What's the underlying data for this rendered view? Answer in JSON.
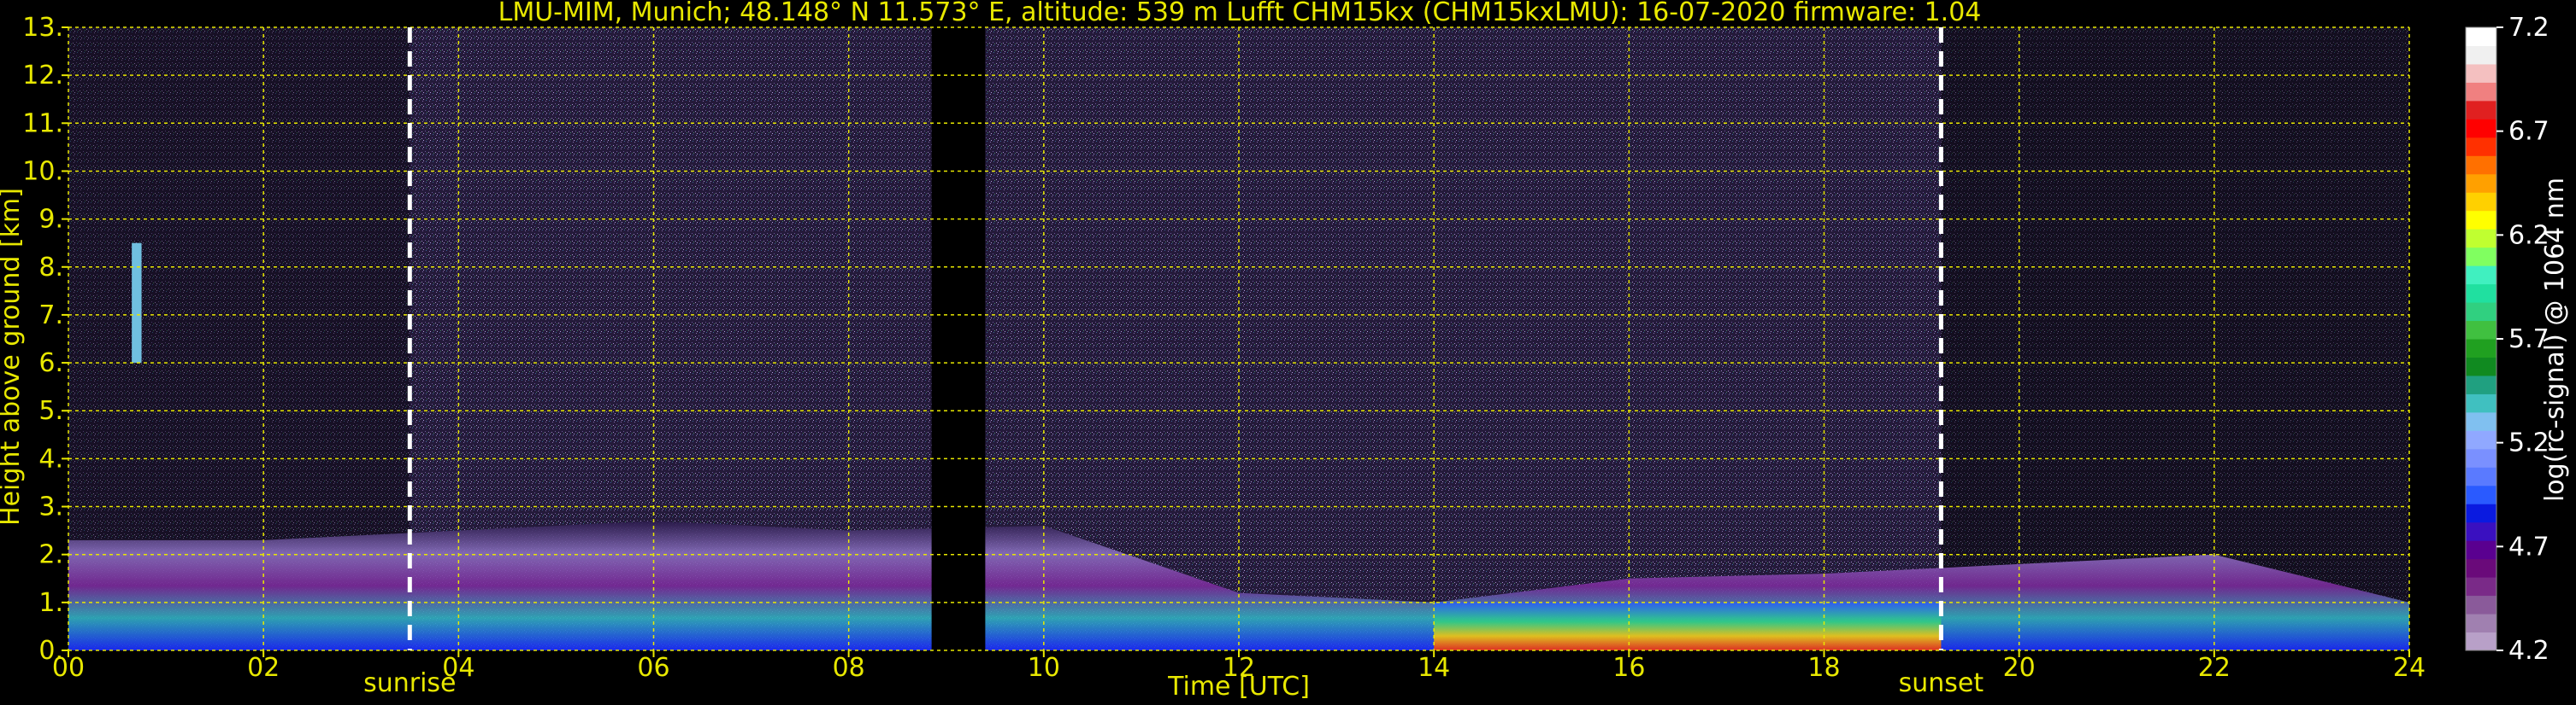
{
  "chart_data": {
    "type": "heatmap",
    "title": "LMU-MIM, Munich; 48.148° N 11.573° E, altitude: 539 m    Lufft CHM15kx (CHM15kxLMU): 16-07-2020    firmware: 1.04",
    "xlabel": "Time [UTC]",
    "ylabel": "Height above ground [km]",
    "xlim": [
      0,
      24
    ],
    "ylim": [
      0,
      13
    ],
    "x_ticks": [
      "00",
      "02",
      "04",
      "06",
      "08",
      "10",
      "12",
      "14",
      "16",
      "18",
      "20",
      "22",
      "24"
    ],
    "x_tick_values": [
      0,
      2,
      4,
      6,
      8,
      10,
      12,
      14,
      16,
      18,
      20,
      22,
      24
    ],
    "y_ticks": [
      "0.",
      "1.",
      "2.",
      "3.",
      "4.",
      "5.",
      "6.",
      "7.",
      "8.",
      "9.",
      "10.",
      "11.",
      "12.",
      "13."
    ],
    "y_tick_values": [
      0,
      1,
      2,
      3,
      4,
      5,
      6,
      7,
      8,
      9,
      10,
      11,
      12,
      13
    ],
    "grid": true,
    "grid_color": "#e8e800",
    "annotations": [
      {
        "label": "sunrise",
        "x": 3.5,
        "style": "dashed-white-line"
      },
      {
        "label": "sunset",
        "x": 19.2,
        "style": "dashed-white-line"
      }
    ],
    "data_gap": {
      "x_start": 8.85,
      "x_end": 9.4
    },
    "colorbar": {
      "label": "log(rc-signal) @ 1064 nm",
      "range": [
        4.2,
        7.2
      ],
      "ticks": [
        "7.2",
        "6.7",
        "6.2",
        "5.7",
        "5.2",
        "4.7",
        "4.2"
      ],
      "tick_values": [
        7.2,
        6.7,
        6.2,
        5.7,
        5.2,
        4.7,
        4.2
      ],
      "colors_low_to_high": [
        "#b8a0c8",
        "#a080b0",
        "#8a5a9a",
        "#7a2a88",
        "#6a0a7a",
        "#5a0090",
        "#3a10c0",
        "#0a1ae0",
        "#2a5aff",
        "#5a7aff",
        "#7a90ff",
        "#90a8ff",
        "#80c0f0",
        "#40c0c0",
        "#20a080",
        "#108a20",
        "#20a020",
        "#40c040",
        "#30d080",
        "#20e0a0",
        "#40f0c0",
        "#80ff60",
        "#c0ff30",
        "#ffff00",
        "#ffd000",
        "#ffa000",
        "#ff7000",
        "#ff3000",
        "#ff0000",
        "#e02020",
        "#f08080",
        "#f4c0c0",
        "#f0f0f0",
        "#ffffff"
      ]
    },
    "features": [
      {
        "name": "boundary layer / aerosol",
        "x": [
          0,
          24
        ],
        "y_top_km": [
          2.3,
          2.3,
          2.5,
          2.7,
          2.5,
          2.6,
          1.2,
          1.0,
          1.5,
          1.6,
          1.8,
          2.0,
          1.0
        ]
      },
      {
        "name": "cloud",
        "x": [
          0.65,
          0.75
        ],
        "y_km": [
          6.0,
          8.5
        ]
      }
    ]
  }
}
